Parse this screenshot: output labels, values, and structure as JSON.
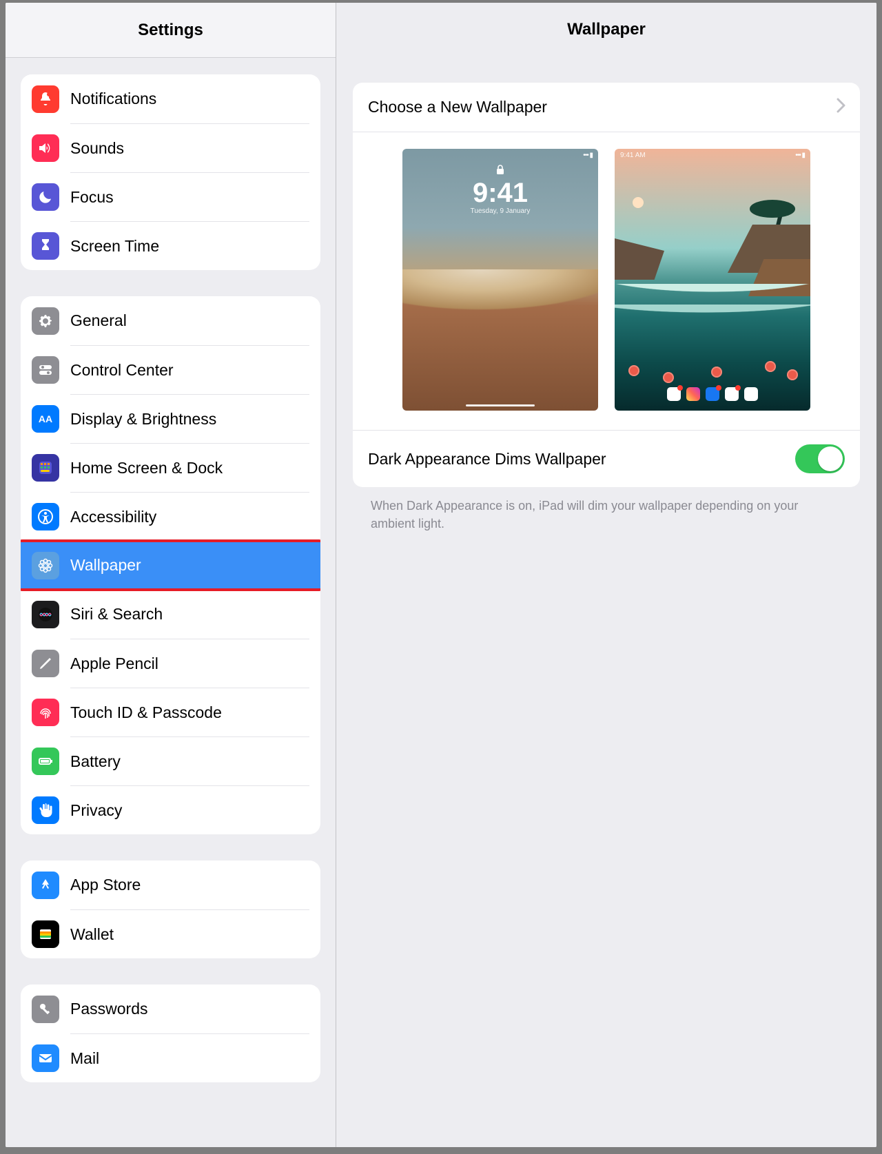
{
  "sidebar": {
    "title": "Settings",
    "groups": [
      {
        "items": [
          {
            "id": "notifications",
            "label": "Notifications",
            "icon": "bell-badge-icon",
            "color": "#ff3b30"
          },
          {
            "id": "sounds",
            "label": "Sounds",
            "icon": "speaker-wave-icon",
            "color": "#ff2d55"
          },
          {
            "id": "focus",
            "label": "Focus",
            "icon": "moon-icon",
            "color": "#5856d6"
          },
          {
            "id": "screen-time",
            "label": "Screen Time",
            "icon": "hourglass-icon",
            "color": "#5856d6"
          }
        ]
      },
      {
        "items": [
          {
            "id": "general",
            "label": "General",
            "icon": "gear-icon",
            "color": "#8e8e93"
          },
          {
            "id": "control-center",
            "label": "Control Center",
            "icon": "switches-icon",
            "color": "#8e8e93"
          },
          {
            "id": "display-brightness",
            "label": "Display & Brightness",
            "icon": "text-size-icon",
            "color": "#007aff"
          },
          {
            "id": "home-screen-dock",
            "label": "Home Screen & Dock",
            "icon": "app-grid-icon",
            "color": "#3634a3"
          },
          {
            "id": "accessibility",
            "label": "Accessibility",
            "icon": "accessibility-icon",
            "color": "#007aff"
          },
          {
            "id": "wallpaper",
            "label": "Wallpaper",
            "icon": "flower-icon",
            "color": "#42b6c8",
            "selected": true,
            "highlighted": true
          },
          {
            "id": "siri-search",
            "label": "Siri & Search",
            "icon": "siri-icon",
            "color": "#1c1c1e"
          },
          {
            "id": "apple-pencil",
            "label": "Apple Pencil",
            "icon": "pencil-icon",
            "color": "#8e8e93"
          },
          {
            "id": "touch-id-passcode",
            "label": "Touch ID & Passcode",
            "icon": "fingerprint-icon",
            "color": "#ff2d55"
          },
          {
            "id": "battery",
            "label": "Battery",
            "icon": "battery-icon",
            "color": "#34c759"
          },
          {
            "id": "privacy",
            "label": "Privacy",
            "icon": "hand-raised-icon",
            "color": "#007aff"
          }
        ]
      },
      {
        "items": [
          {
            "id": "app-store",
            "label": "App Store",
            "icon": "appstore-icon",
            "color": "#1f8bff"
          },
          {
            "id": "wallet",
            "label": "Wallet",
            "icon": "wallet-icon",
            "color": "#000000"
          }
        ]
      },
      {
        "items": [
          {
            "id": "passwords",
            "label": "Passwords",
            "icon": "key-icon",
            "color": "#8e8e93"
          },
          {
            "id": "mail",
            "label": "Mail",
            "icon": "mail-icon",
            "color": "#1f8bff"
          }
        ]
      }
    ]
  },
  "detail": {
    "title": "Wallpaper",
    "choose_label": "Choose a New Wallpaper",
    "lock_preview": {
      "time": "9:41",
      "date": "Tuesday, 9 January"
    },
    "home_preview_status_time": "9:41 AM",
    "dark_dims_label": "Dark Appearance Dims Wallpaper",
    "dark_dims_on": true,
    "note": "When Dark Appearance is on, iPad will dim your wallpaper depending on your ambient light."
  }
}
